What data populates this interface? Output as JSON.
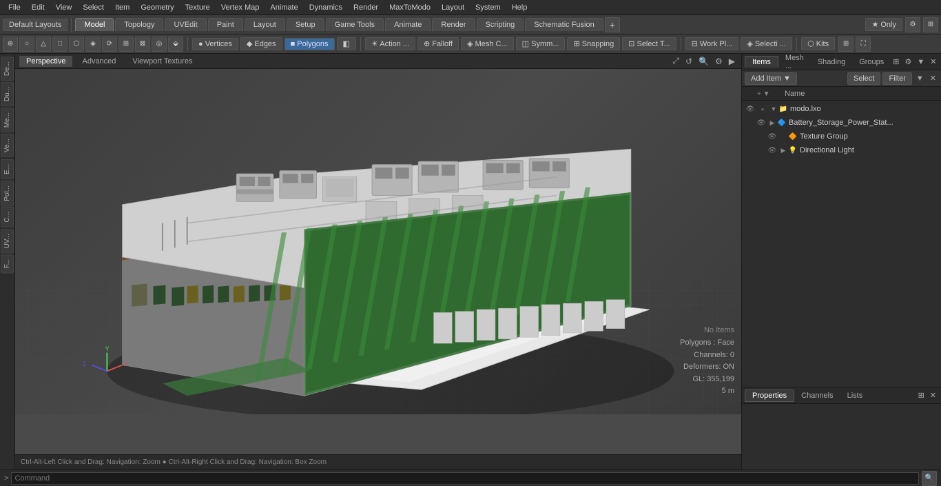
{
  "menubar": {
    "items": [
      "File",
      "Edit",
      "View",
      "Select",
      "Item",
      "Geometry",
      "Texture",
      "Vertex Map",
      "Animate",
      "Dynamics",
      "Render",
      "MaxToModo",
      "Layout",
      "System",
      "Help"
    ]
  },
  "toolbar1": {
    "layout_label": "Default Layouts",
    "tabs": [
      {
        "label": "Model",
        "active": true
      },
      {
        "label": "Topology",
        "active": false
      },
      {
        "label": "UVEdit",
        "active": false
      },
      {
        "label": "Paint",
        "active": false
      },
      {
        "label": "Layout",
        "active": false
      },
      {
        "label": "Setup",
        "active": false
      },
      {
        "label": "Game Tools",
        "active": false
      },
      {
        "label": "Animate",
        "active": false
      },
      {
        "label": "Render",
        "active": false
      },
      {
        "label": "Scripting",
        "active": false
      },
      {
        "label": "Schematic Fusion",
        "active": false
      }
    ],
    "plus_label": "+",
    "star_label": "★ Only"
  },
  "toolbar2": {
    "tools": [
      {
        "label": "⊕",
        "name": "center-icon"
      },
      {
        "label": "○",
        "name": "circle-icon"
      },
      {
        "label": "△",
        "name": "triangle-icon"
      },
      {
        "label": "□",
        "name": "square-icon"
      },
      {
        "label": "⬡",
        "name": "hex-icon"
      },
      {
        "label": "◈",
        "name": "diamond-icon"
      },
      {
        "label": "⟳",
        "name": "rotate-icon"
      },
      {
        "label": "⊞",
        "name": "grid-icon"
      },
      {
        "label": "⊠",
        "name": "x-icon"
      },
      {
        "label": "◎",
        "name": "target-icon"
      },
      {
        "label": "⬙",
        "name": "move-icon"
      }
    ],
    "mode_buttons": [
      {
        "label": "● Vertices",
        "active": false
      },
      {
        "label": "◆ Edges",
        "active": false
      },
      {
        "label": "■ Polygons",
        "active": true
      },
      {
        "label": "◧",
        "active": false
      }
    ],
    "extra_tools": [
      {
        "label": "☀ Action ...",
        "name": "action-btn"
      },
      {
        "label": "⊕ Falloff",
        "name": "falloff-btn"
      },
      {
        "label": "◈ Mesh C...",
        "name": "mesh-btn"
      },
      {
        "label": "◫ Symm...",
        "name": "symm-btn"
      },
      {
        "label": "⊞ Snapping",
        "name": "snapping-btn"
      },
      {
        "label": "⊡ Select T...",
        "name": "select-tool-btn"
      },
      {
        "label": "⊟ Work Pl...",
        "name": "work-plane-btn"
      },
      {
        "label": "◈ Selecti ...",
        "name": "selecti-btn"
      },
      {
        "label": "⬡ Kits",
        "name": "kits-btn"
      }
    ]
  },
  "viewport": {
    "tabs": [
      "Perspective",
      "Advanced",
      "Viewport Textures"
    ],
    "active_tab": "Perspective",
    "status": {
      "no_items": "No Items",
      "polygons": "Polygons : Face",
      "channels": "Channels: 0",
      "deformers": "Deformers: ON",
      "gl": "GL: 355,199",
      "distance": "5 m"
    },
    "nav_hint": "Ctrl-Alt-Left Click and Drag: Navigation: Zoom  ●  Ctrl-Alt-Right Click and Drag: Navigation: Box Zoom"
  },
  "left_sidebar": {
    "tabs": [
      "De...",
      "Du...",
      "Me...",
      "Ve...",
      "E...",
      "Pol...",
      "C...",
      "UV...",
      "F..."
    ]
  },
  "right_panel": {
    "tabs": [
      "Items",
      "Mesh ...",
      "Shading",
      "Groups"
    ],
    "active_tab": "Items",
    "toolbar": {
      "add_item": "Add Item",
      "select": "Select",
      "filter": "Filter"
    },
    "column_header": {
      "name": "Name"
    },
    "tree": [
      {
        "id": "modo-lxo",
        "label": "modo.lxo",
        "indent": 0,
        "expand": "▼",
        "icon": "📦",
        "eye": true
      },
      {
        "id": "battery-storage",
        "label": "Battery_Storage_Power_Stat...",
        "indent": 1,
        "expand": "▶",
        "icon": "🔷",
        "eye": true
      },
      {
        "id": "texture-group",
        "label": "Texture Group",
        "indent": 2,
        "expand": "",
        "icon": "🔶",
        "eye": true
      },
      {
        "id": "directional-light",
        "label": "Directional Light",
        "indent": 2,
        "expand": "▶",
        "icon": "💡",
        "eye": true
      }
    ]
  },
  "properties_panel": {
    "tabs": [
      "Properties",
      "Channels",
      "Lists"
    ],
    "active_tab": "Properties"
  },
  "command_bar": {
    "prompt": ">",
    "placeholder": "Command",
    "search_icon": "🔍"
  }
}
